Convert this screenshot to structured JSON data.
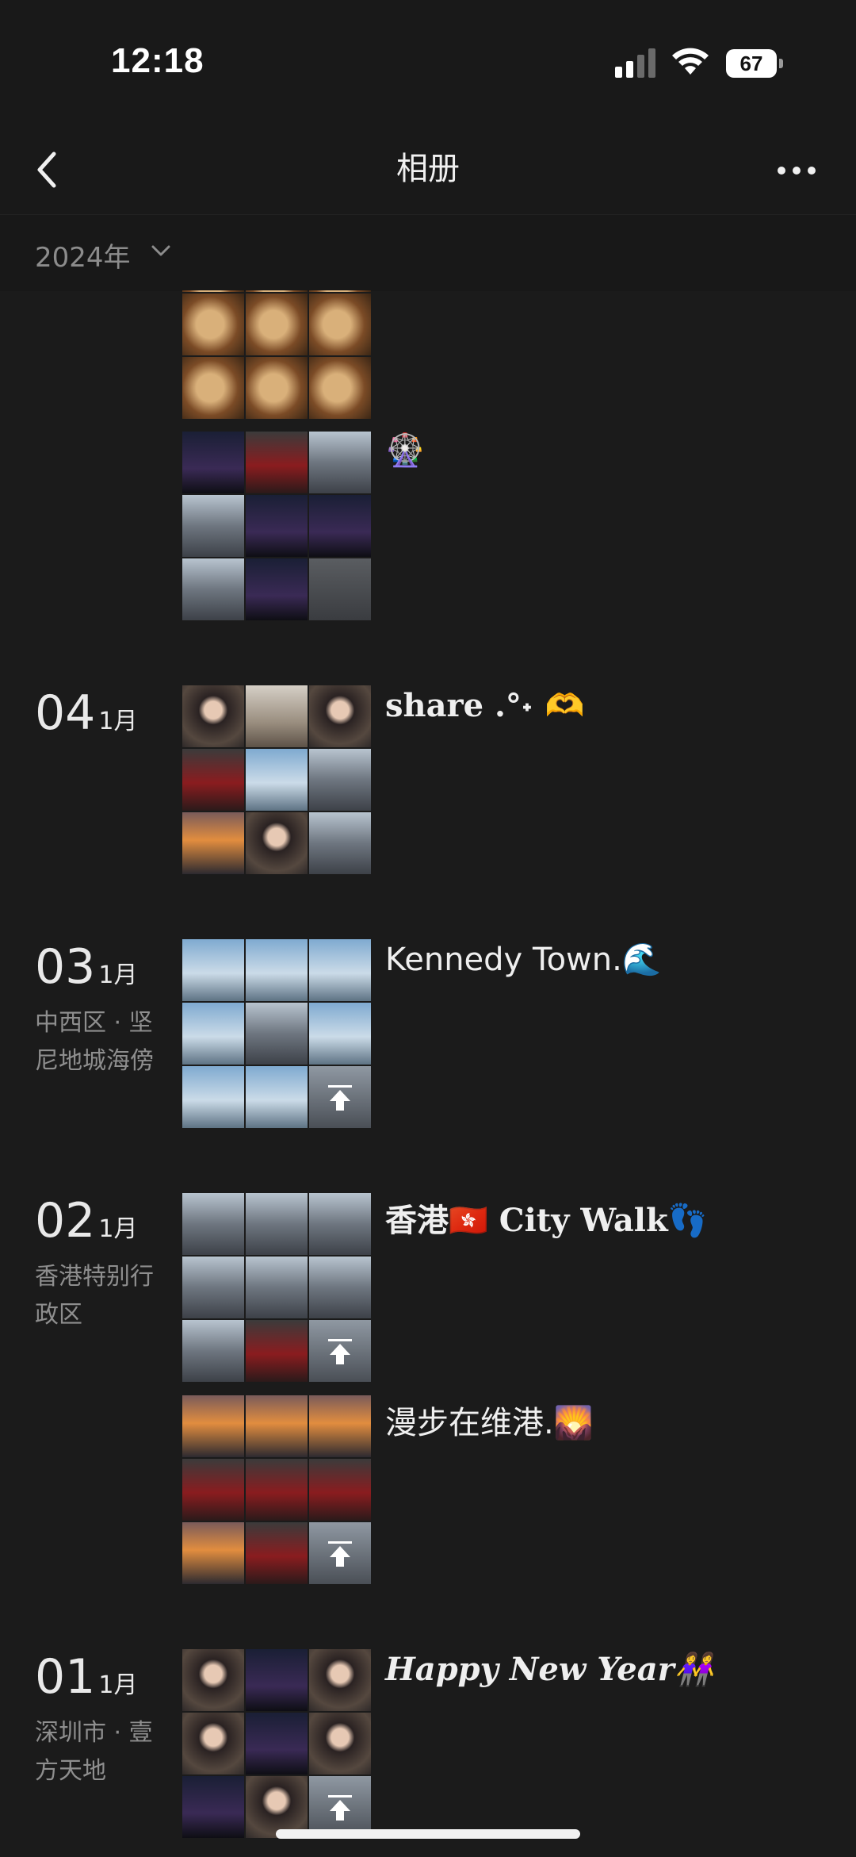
{
  "status": {
    "time": "12:18",
    "battery": "67"
  },
  "nav": {
    "title": "相册"
  },
  "year_filter": {
    "label": "2024年"
  },
  "colors": {
    "bg": "#1b1b1b",
    "text": "#e9e9e9",
    "muted": "#8e8e8e",
    "sky_blue": "#7faad0",
    "night": "#1a1f35",
    "sunset": "#e28d3f",
    "food": "#a57042",
    "red_coat": "#8a1c1f"
  },
  "posts": [
    {
      "day": "",
      "month": "",
      "location": [],
      "caption": "🎡",
      "tiles": [
        "food",
        "food",
        "food",
        "food",
        "food",
        "food",
        "food",
        "food",
        "food"
      ]
    },
    {
      "day": "",
      "month": "",
      "location": [],
      "caption": "🎡",
      "tiles": [
        "night",
        "red",
        "city",
        "city",
        "night",
        "night",
        "city",
        "night",
        "gray"
      ]
    },
    {
      "day": "04",
      "month": "1月",
      "location": [],
      "caption": "share .°˖ 🫶",
      "tiles": [
        "portrait",
        "coffee",
        "portrait",
        "red",
        "sky",
        "city",
        "sunset",
        "portrait",
        "city"
      ]
    },
    {
      "day": "03",
      "month": "1月",
      "location": [
        "中西区 · 坚",
        "尼地城海傍"
      ],
      "caption": "Kennedy Town.🌊",
      "tiles": [
        "sky",
        "sky",
        "sky",
        "sky",
        "city",
        "sky",
        "sky",
        "sky",
        "up"
      ]
    },
    {
      "day": "02",
      "month": "1月",
      "location": [
        "香港特别行",
        "政区"
      ],
      "caption": "香港🇭🇰 City Walk👣",
      "tiles": [
        "city",
        "city",
        "city",
        "city",
        "city",
        "city",
        "city",
        "red",
        "up"
      ]
    },
    {
      "day": "",
      "month": "",
      "location": [],
      "caption": "漫步在维港.🌄",
      "tiles": [
        "sunset",
        "sunset",
        "sunset",
        "red",
        "red",
        "red",
        "sunset",
        "red",
        "up"
      ]
    },
    {
      "day": "01",
      "month": "1月",
      "location": [
        "深圳市 · 壹",
        "方天地"
      ],
      "caption": "Happy New Year👭",
      "tiles": [
        "portrait",
        "night",
        "portrait",
        "portrait",
        "night",
        "portrait",
        "night",
        "portrait",
        "up"
      ]
    }
  ]
}
